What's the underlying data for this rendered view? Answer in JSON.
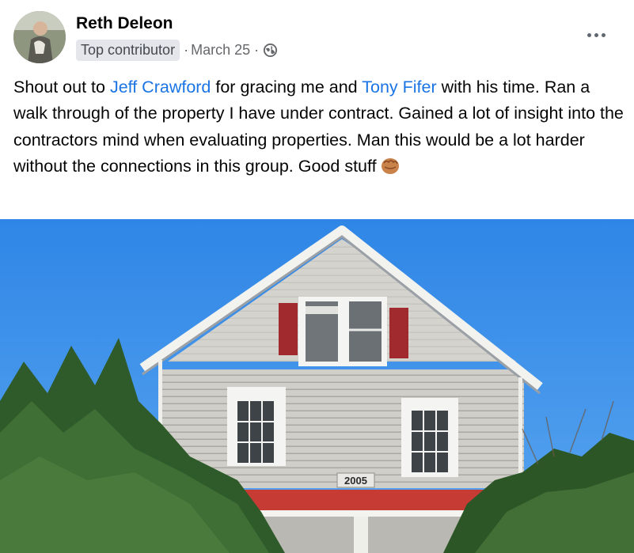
{
  "post": {
    "author": "Reth Deleon",
    "badge": "Top contributor",
    "separator": "·",
    "date": "March 25",
    "privacy_icon": "globe-icon",
    "menu_icon": "more-options-icon",
    "body": {
      "seg1": "Shout out to ",
      "mention1": "Jeff Crawford",
      "seg2": " for gracing me and ",
      "mention2": "Tony Fifer",
      "seg3": " with his time. Ran a walk through of the property I have under contract. Gained a lot of insight into the contractors mind when evaluating properties. Man this would be a lot harder without the connections in this group. Good stuff",
      "emoji": "fist-bump-emoji"
    },
    "photo": {
      "house_number": "2005"
    }
  },
  "colors": {
    "link": "#1b74e4",
    "sky": "#3b8ee8",
    "siding": "#c7c6c0",
    "shutter": "#a12a2e",
    "roof_trim": "#c63b34"
  }
}
